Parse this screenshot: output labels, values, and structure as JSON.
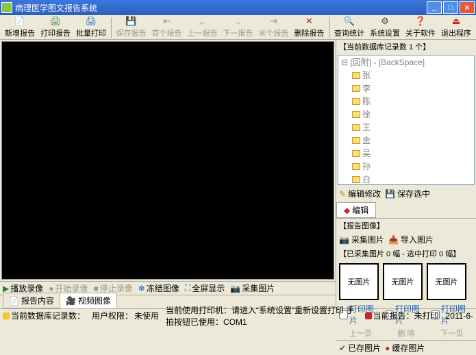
{
  "window": {
    "title": "病理医学图文报告系统"
  },
  "toolbar": [
    {
      "label": "新增报告",
      "enabled": true,
      "icon": "📄",
      "color": "#2e7d32"
    },
    {
      "label": "打印报告",
      "enabled": true,
      "icon": "🖨",
      "color": "#2e7d32"
    },
    {
      "label": "批量打印",
      "enabled": true,
      "icon": "🖨",
      "color": "#1565c0"
    },
    {
      "sep": true
    },
    {
      "label": "保存报告",
      "enabled": false,
      "icon": "💾"
    },
    {
      "label": "首个报告",
      "enabled": false,
      "icon": "⇤"
    },
    {
      "label": "上一报告",
      "enabled": false,
      "icon": "←"
    },
    {
      "label": "下一报告",
      "enabled": false,
      "icon": "→"
    },
    {
      "label": "末个报告",
      "enabled": false,
      "icon": "⇥"
    },
    {
      "label": "删除报告",
      "enabled": true,
      "icon": "✕",
      "color": "#c62828"
    },
    {
      "sep": true
    },
    {
      "label": "查询统计",
      "enabled": true,
      "icon": "🔍",
      "color": "#1565c0"
    },
    {
      "label": "系统设置",
      "enabled": true,
      "icon": "⚙",
      "color": "#5d4037"
    },
    {
      "label": "关于软件",
      "enabled": true,
      "icon": "❓",
      "color": "#6a1b9a"
    },
    {
      "label": "退出程序",
      "enabled": true,
      "icon": "⏏",
      "color": "#c62828"
    }
  ],
  "video_toolbar": {
    "play": "播放录像",
    "start": "开始录像",
    "stop": "停止录像",
    "freeze": "冻结图像",
    "fullscreen": "全屏显示",
    "capture": "采集图片"
  },
  "left_tabs": {
    "report": "报告内容",
    "video": "视频图像"
  },
  "right": {
    "record_count": "【当前数据库记录数 1 个】",
    "tree_root": "[回附] - [BackSpace]",
    "tree_items": [
      "张",
      "李",
      "陈",
      "徐",
      "王",
      "金",
      "吴",
      "孙",
      "白"
    ],
    "edit_modify": "编辑修改",
    "save_selected": "保存选中",
    "edit_tab": "编辑",
    "report_image": "【报告图像】",
    "capture_img": "采集图片",
    "import_img": "导入图片",
    "captured_info": "【已采集图片 0 幅 - 选中打印 0 幅】",
    "no_image": "无图片",
    "print_img": "打印图片",
    "prev": "上一页",
    "delete": "删 除",
    "next": "下一页",
    "save_img": "已存图片",
    "cache_img": "缓存图片"
  },
  "statusbar": {
    "records": "当前数据库记录数：",
    "perm_label": "用户权限：",
    "perm_val": "未使用",
    "printer": "当前使用打印机：请进入“系统设置”重新设置打印 手拍按钮已使用：COM1",
    "report_status": "当前报告：未打印",
    "date": "2011-6-"
  }
}
